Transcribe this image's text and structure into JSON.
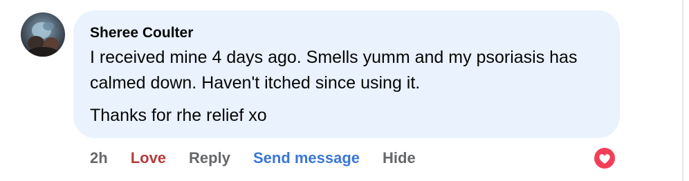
{
  "comment": {
    "author": "Sheree Coulter",
    "paragraphs": [
      "I received mine 4 days ago. Smells yumm and my psoriasis has calmed down. Haven't itched since using it.",
      "Thanks for rhe relief xo"
    ]
  },
  "actions": {
    "time": "2h",
    "love_label": "Love",
    "reply_label": "Reply",
    "send_message_label": "Send message",
    "hide_label": "Hide"
  },
  "reaction": {
    "icon": "heart-icon",
    "color": "#f33e58"
  },
  "colors": {
    "bubble": "#e9f2fd",
    "love": "#b83b3c",
    "send_message": "#3b76d4",
    "muted": "#65676b"
  }
}
